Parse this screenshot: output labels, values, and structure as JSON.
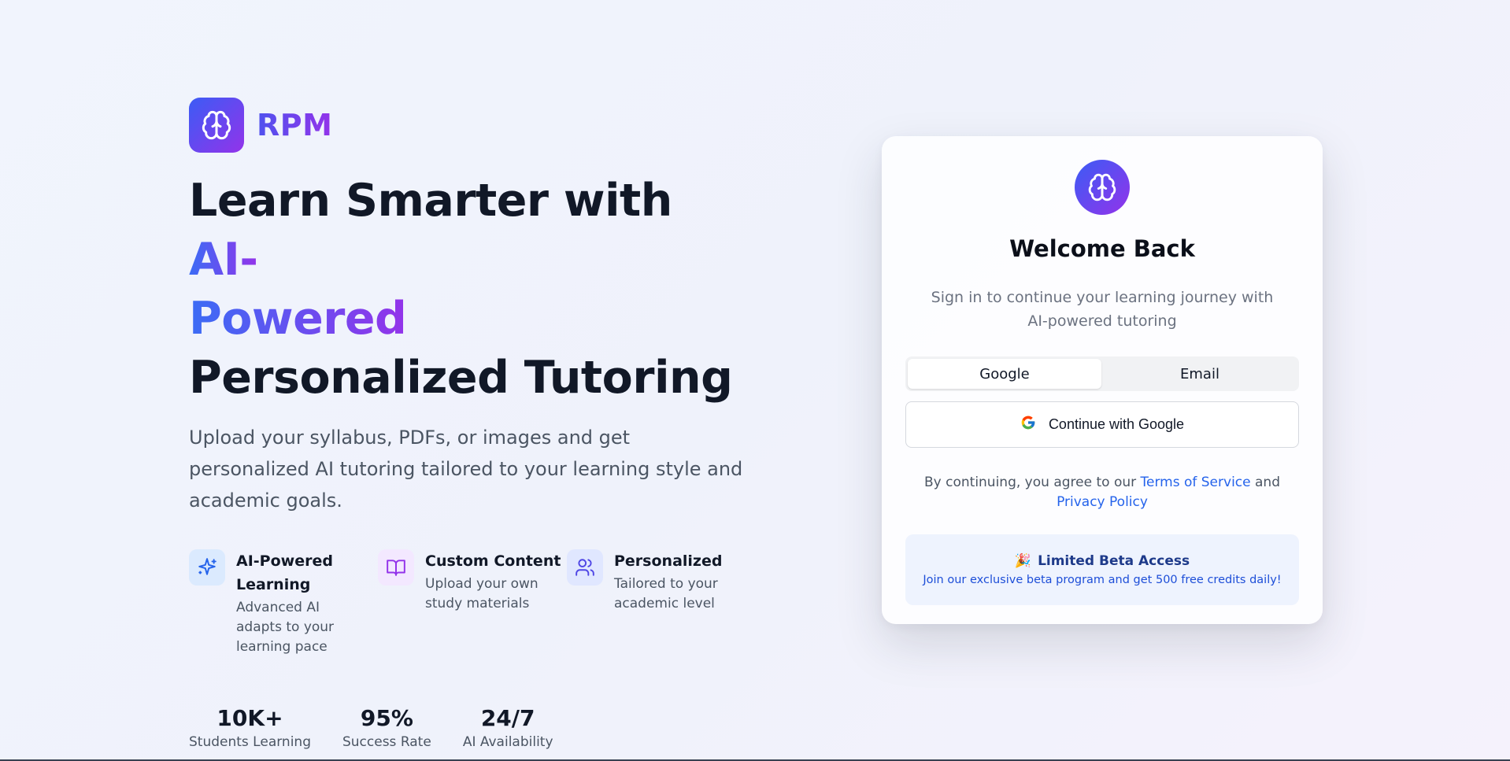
{
  "brand": {
    "name": "RPM",
    "logo_icon": "brain-icon",
    "gradient": [
      "#3b5cf5",
      "#9333ea"
    ]
  },
  "hero": {
    "headline_part1": "Learn Smarter with ",
    "headline_highlight1": "AI-",
    "headline_highlight2": "Powered",
    "headline_part2": "Personalized Tutoring",
    "subhead": "Upload your syllabus, PDFs, or images and get personalized AI tutoring tailored to your learning style and academic goals."
  },
  "features": [
    {
      "icon": "sparkles-icon",
      "title": "AI-Powered Learning",
      "desc": "Advanced AI adapts to your learning pace"
    },
    {
      "icon": "book-open-icon",
      "title": "Custom Content",
      "desc": "Upload your own study materials"
    },
    {
      "icon": "users-icon",
      "title": "Personalized",
      "desc": "Tailored to your academic level"
    }
  ],
  "stats": [
    {
      "value": "10K+",
      "label": "Students Learning"
    },
    {
      "value": "95%",
      "label": "Success Rate"
    },
    {
      "value": "24/7",
      "label": "AI Availability"
    }
  ],
  "login": {
    "title": "Welcome Back",
    "subtitle": "Sign in to continue your learning journey with AI-powered tutoring",
    "tabs": [
      {
        "label": "Google",
        "active": true
      },
      {
        "label": "Email",
        "active": false
      }
    ],
    "google_button": "Continue with Google",
    "terms_prefix": "By continuing, you agree to our ",
    "terms_link": "Terms of Service",
    "terms_and": " and ",
    "privacy_link": "Privacy Policy",
    "beta_emoji": "🎉",
    "beta_title": "Limited Beta Access",
    "beta_desc": "Join our exclusive beta program and get 500 free credits daily!"
  },
  "colors": {
    "accent_blue": "#2563eb",
    "accent_purple": "#9333ea",
    "beta_bg": "#eef3fe"
  }
}
